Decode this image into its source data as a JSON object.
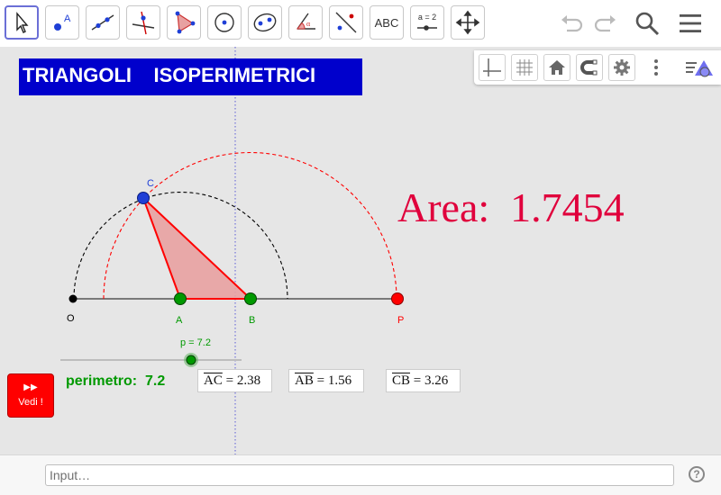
{
  "toolbar": {
    "tools": [
      {
        "id": "move",
        "icon": "cursor-icon"
      },
      {
        "id": "point",
        "icon": "point-icon",
        "label": "A"
      },
      {
        "id": "line",
        "icon": "line-icon"
      },
      {
        "id": "perpendicular",
        "icon": "perpendicular-line-icon"
      },
      {
        "id": "polygon",
        "icon": "polygon-icon"
      },
      {
        "id": "circle-center-point",
        "icon": "circle-icon"
      },
      {
        "id": "ellipse",
        "icon": "ellipse-icon"
      },
      {
        "id": "angle",
        "icon": "angle-icon",
        "label": "α"
      },
      {
        "id": "reflect",
        "icon": "reflect-icon"
      },
      {
        "id": "text",
        "icon": "text-icon",
        "label": "ABC"
      },
      {
        "id": "slider",
        "icon": "slider-icon",
        "label": "a = 2"
      },
      {
        "id": "move-graphics",
        "icon": "move-graphics-icon"
      }
    ],
    "right": [
      "undo-icon",
      "redo-icon",
      "search-icon",
      "menu-icon"
    ]
  },
  "title": {
    "left": "TRIANGOLI",
    "right": "ISOPERIMETRICI"
  },
  "style_bar": [
    "axes-icon",
    "grid-icon",
    "home-icon",
    "magnet-icon",
    "gear-icon",
    "more-icon",
    "style-toggle-icon"
  ],
  "construction": {
    "points": {
      "O": "O",
      "A": "A",
      "B": "B",
      "C": "C",
      "P": "P"
    },
    "colors": {
      "triangle": "#ff0000",
      "triangle_fill": "#e8a1a1",
      "points_green": "#009900",
      "point_c": "#1f3fd6",
      "point_p": "#ff0000",
      "point_o": "#000000",
      "arc_red": "#ff0000",
      "arc_black": "#000000",
      "axis": "#555555"
    }
  },
  "slider": {
    "label": "p = 7.2",
    "value": 7.2
  },
  "area": {
    "label": "Area:",
    "value": "1.7454"
  },
  "perimetro": {
    "label": "perimetro:",
    "value": "7.2"
  },
  "segments": [
    {
      "name": "AC",
      "value": "2.38"
    },
    {
      "name": "AB",
      "value": "1.56"
    },
    {
      "name": "CB",
      "value": "3.26"
    }
  ],
  "vedi_button": {
    "icon": "fast-forward-icon",
    "label": "Vedi !"
  },
  "input": {
    "placeholder": "Input…"
  },
  "help": {
    "label": "?"
  }
}
